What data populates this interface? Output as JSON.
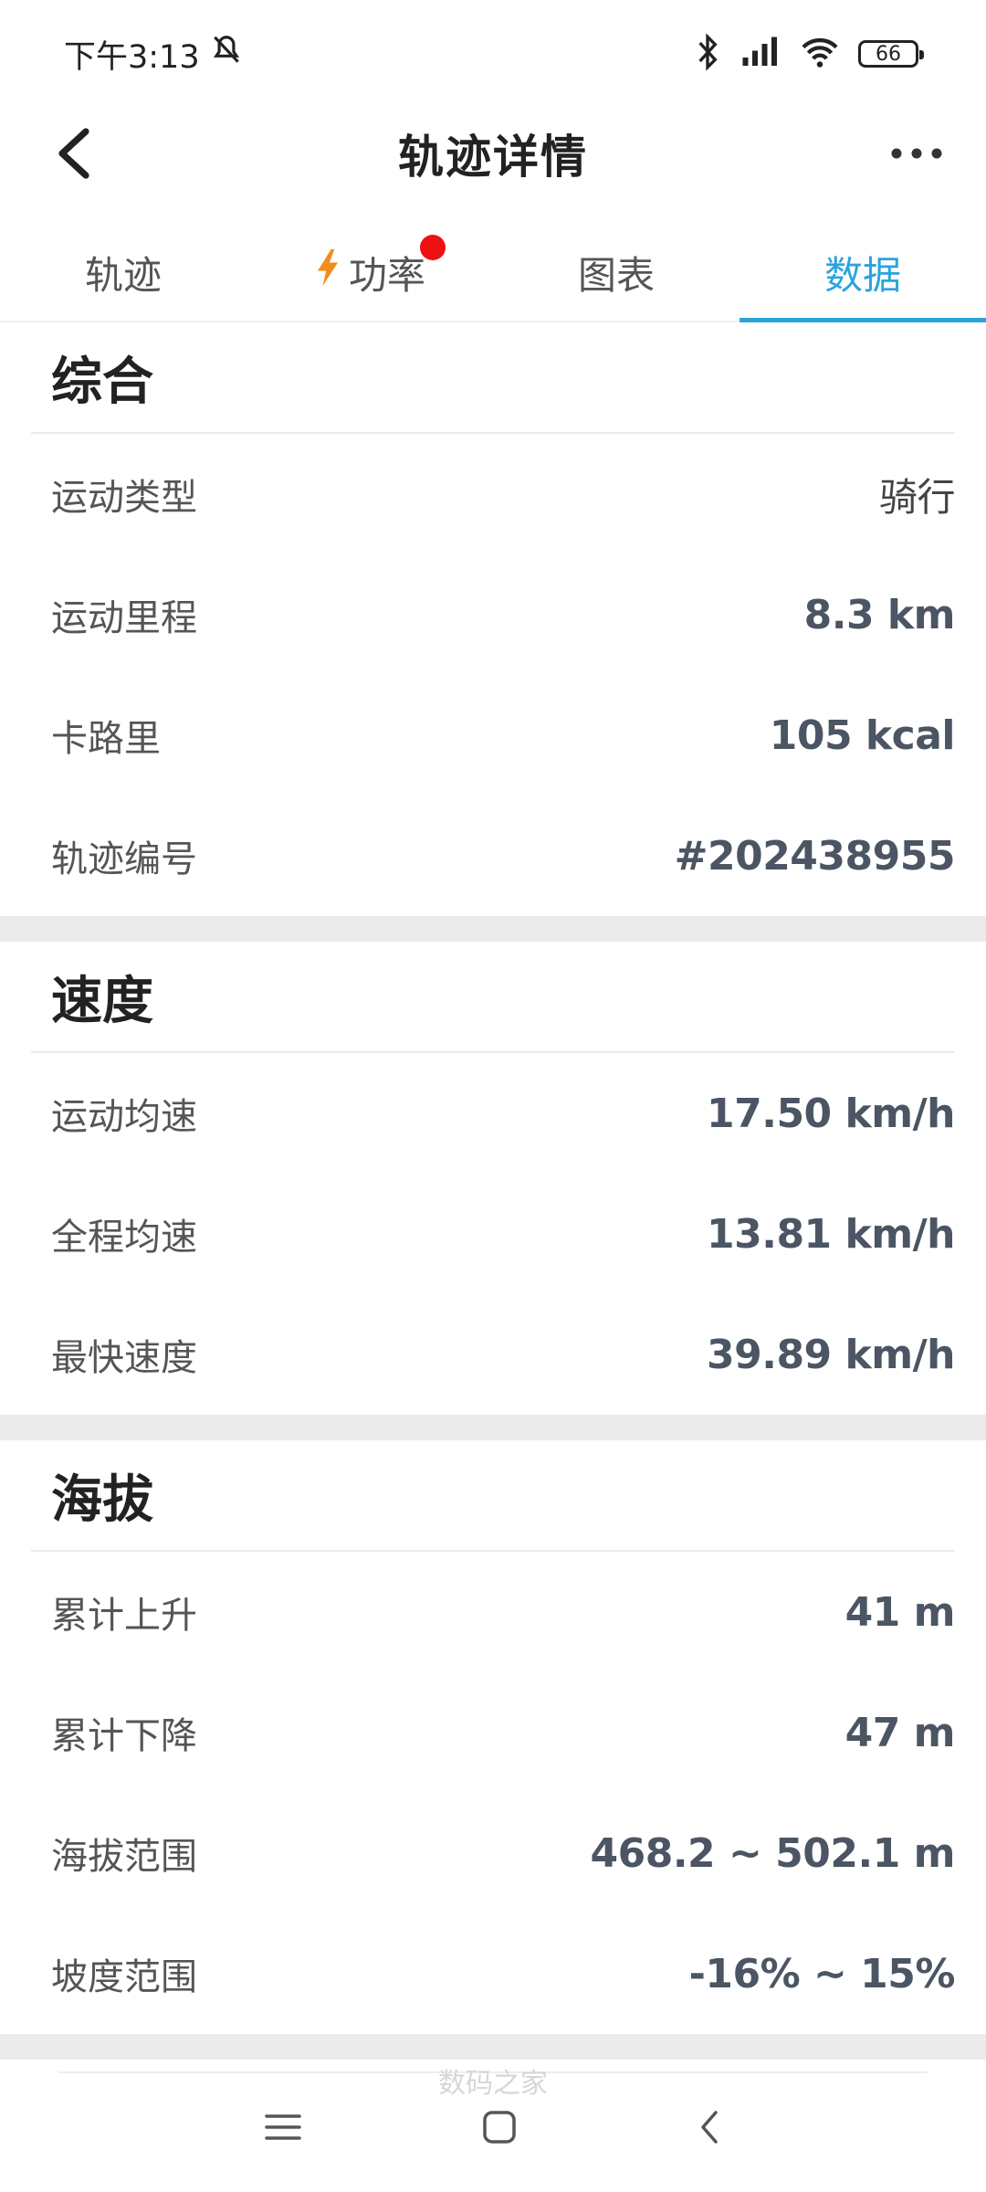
{
  "status_bar": {
    "time": "下午3:13",
    "battery": "66"
  },
  "header": {
    "title": "轨迹详情"
  },
  "tabs": [
    {
      "label": "轨迹"
    },
    {
      "label": "功率"
    },
    {
      "label": "图表"
    },
    {
      "label": "数据"
    }
  ],
  "sections": {
    "summary": {
      "title": "综合",
      "rows": [
        {
          "label": "运动类型",
          "value": "骑行"
        },
        {
          "label": "运动里程",
          "value": "8.3 km"
        },
        {
          "label": "卡路里",
          "value": "105 kcal"
        },
        {
          "label": "轨迹编号",
          "value": "#202438955"
        }
      ]
    },
    "speed": {
      "title": "速度",
      "rows": [
        {
          "label": "运动均速",
          "value": "17.50 km/h"
        },
        {
          "label": "全程均速",
          "value": "13.81 km/h"
        },
        {
          "label": "最快速度",
          "value": "39.89 km/h"
        }
      ]
    },
    "altitude": {
      "title": "海拔",
      "rows": [
        {
          "label": "累计上升",
          "value": "41 m"
        },
        {
          "label": "累计下降",
          "value": "47 m"
        },
        {
          "label": "海拔范围",
          "value": "468.2 ~ 502.1 m"
        },
        {
          "label": "坡度范围",
          "value": "-16% ~ 15%"
        }
      ]
    }
  },
  "watermark": "数码之家",
  "colors": {
    "accent": "#2aa4dd",
    "badge": "#ee1111",
    "bolt": "#f28c1b"
  }
}
